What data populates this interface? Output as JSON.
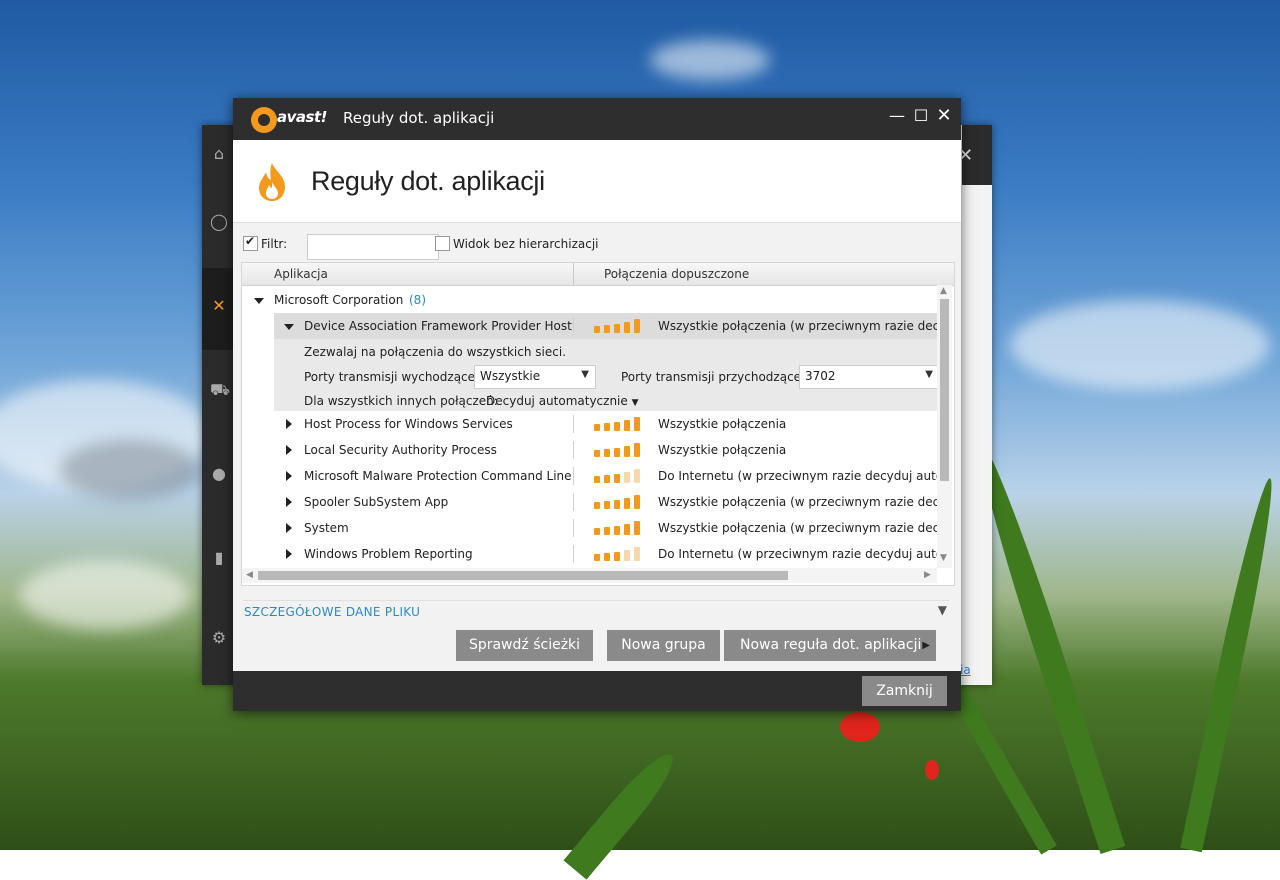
{
  "window": {
    "brand": "avast!",
    "title": "Reguły dot. aplikacji",
    "heading": "Reguły dot. aplikacji"
  },
  "filter": {
    "label": "Filtr:",
    "value": "",
    "checked": true,
    "flat_view_label": "Widok bez hierarchizacji",
    "flat_view_checked": false
  },
  "table": {
    "columns": [
      "Aplikacja",
      "Połączenia dopuszczone"
    ],
    "group": {
      "name": "Microsoft Corporation",
      "count": "(8)"
    },
    "expanded_row": {
      "name": "Device Association Framework Provider Host",
      "level": 5,
      "connections": "Wszystkie połączenia (w przeciwnym razie decydu"
    },
    "detail": {
      "allow_text": "Zezwalaj na połączenia do wszystkich sieci.",
      "outgoing_label": "Porty transmisji wychodzącej:",
      "outgoing_value": "Wszystkie",
      "incoming_label": "Porty transmisji przychodzącej:",
      "incoming_value": "3702",
      "other_label": "Dla wszystkich innych połączeń:",
      "other_value": "Decyduj automatycznie"
    },
    "rows": [
      {
        "name": "Host Process for Windows Services",
        "level": 5,
        "connections": "Wszystkie połączenia"
      },
      {
        "name": "Local Security Authority Process",
        "level": 5,
        "connections": "Wszystkie połączenia"
      },
      {
        "name": "Microsoft Malware Protection Command Line ...",
        "level": 3,
        "connections": "Do Internetu (w przeciwnym razie decyduj automa"
      },
      {
        "name": "Spooler SubSystem App",
        "level": 5,
        "connections": "Wszystkie połączenia (w przeciwnym razie decydu"
      },
      {
        "name": "System",
        "level": 5,
        "connections": "Wszystkie połączenia (w przeciwnym razie decydu"
      },
      {
        "name": "Windows Problem Reporting",
        "level": 3,
        "connections": "Do Internetu (w przeciwnym razie decyduj automa"
      }
    ]
  },
  "file_details": {
    "label": "SZCZEGÓŁOWE DANE PLIKU"
  },
  "buttons": {
    "check_paths": "Sprawdź ścieżki",
    "new_group": "Nowa grupa",
    "new_rule": "Nowa reguła dot. aplikacji",
    "close": "Zamknij"
  },
  "colors": {
    "accent": "#f39a1e",
    "bar_on": "#f39a1e",
    "bar_off": "#f5d9a8",
    "link": "#2a8ac8",
    "titlebar": "#2e2e2e",
    "button": "#8a8a8a"
  }
}
